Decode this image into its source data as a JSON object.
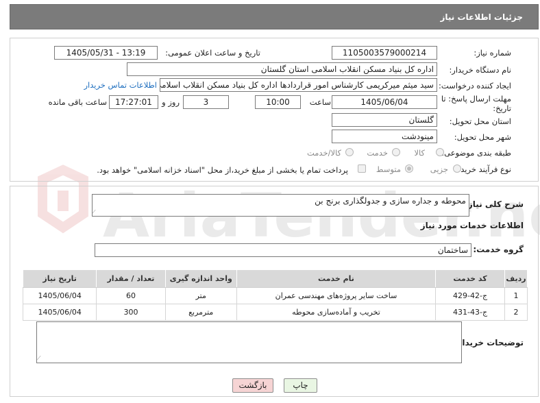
{
  "header": {
    "title": "جزئیات اطلاعات نیاز"
  },
  "fields": {
    "need_number_label": "شماره نیاز:",
    "need_number": "1105003579000214",
    "announce_label": "تاریخ و ساعت اعلان عمومی:",
    "announce_value": "1405/05/31 - 13:19",
    "buyer_org_label": "نام دستگاه خریدار:",
    "buyer_org": "اداره کل بنیاد مسکن انقلاب اسلامی استان گلستان",
    "creator_label": "ایجاد کننده درخواست:",
    "creator": "سید میثم میرکریمی کارشناس امور قراردادها اداره کل بنیاد مسکن انقلاب اسلامی",
    "contact_link": "اطلاعات تماس خریدار",
    "deadline_label_1": "مهلت ارسال پاسخ: تا",
    "deadline_label_2": "تاریخ:",
    "deadline_date": "1405/06/04",
    "time_label": "ساعت",
    "deadline_time": "10:00",
    "days_count": "3",
    "days_label": "روز و",
    "remaining_time": "17:27:01",
    "remaining_label": "ساعت باقی مانده",
    "province_label": "استان محل تحویل:",
    "province": "گلستان",
    "city_label": "شهر محل تحویل:",
    "city": "مینودشت",
    "category_label": "طبقه بندی موضوعی:",
    "category_options": [
      "کالا",
      "خدمت",
      "کالا/خدمت"
    ],
    "process_label": "نوع فرآیند خرید :",
    "process_options": [
      "جزیی",
      "متوسط"
    ],
    "payment_note": "پرداخت تمام یا بخشی از مبلغ خرید،از محل \"اسناد خزانه اسلامی\" خواهد بود."
  },
  "description": {
    "label": "شرح کلی نیاز:",
    "value": "محوطه و جداره سازی و جدولگذاری برنج بن"
  },
  "services": {
    "section_title": "اطلاعات خدمات مورد نیاز",
    "group_label": "گروه خدمت:",
    "group_value": "ساختمان",
    "columns": [
      "ردیف",
      "کد خدمت",
      "نام خدمت",
      "واحد اندازه گیری",
      "تعداد / مقدار",
      "تاریخ نیاز"
    ],
    "rows": [
      [
        "1",
        "ج-42-429",
        "ساخت سایر پروژه‌های مهندسی عمران",
        "متر",
        "60",
        "1405/06/04"
      ],
      [
        "2",
        "ج-43-431",
        "تخریب و آماده‌سازی محوطه",
        "مترمربع",
        "300",
        "1405/06/04"
      ]
    ]
  },
  "buyer_notes": {
    "label": "توضیحات خریدار:",
    "value": ""
  },
  "buttons": {
    "print": "چاپ",
    "back": "بازگشت"
  },
  "watermark": {
    "text": "AriaTender.net"
  },
  "colors": {
    "header_bg": "#7b7b7b",
    "link": "#1f6fbf",
    "back_button_bg": "#f6d4d4",
    "print_button_bg": "#e9f6e3"
  }
}
